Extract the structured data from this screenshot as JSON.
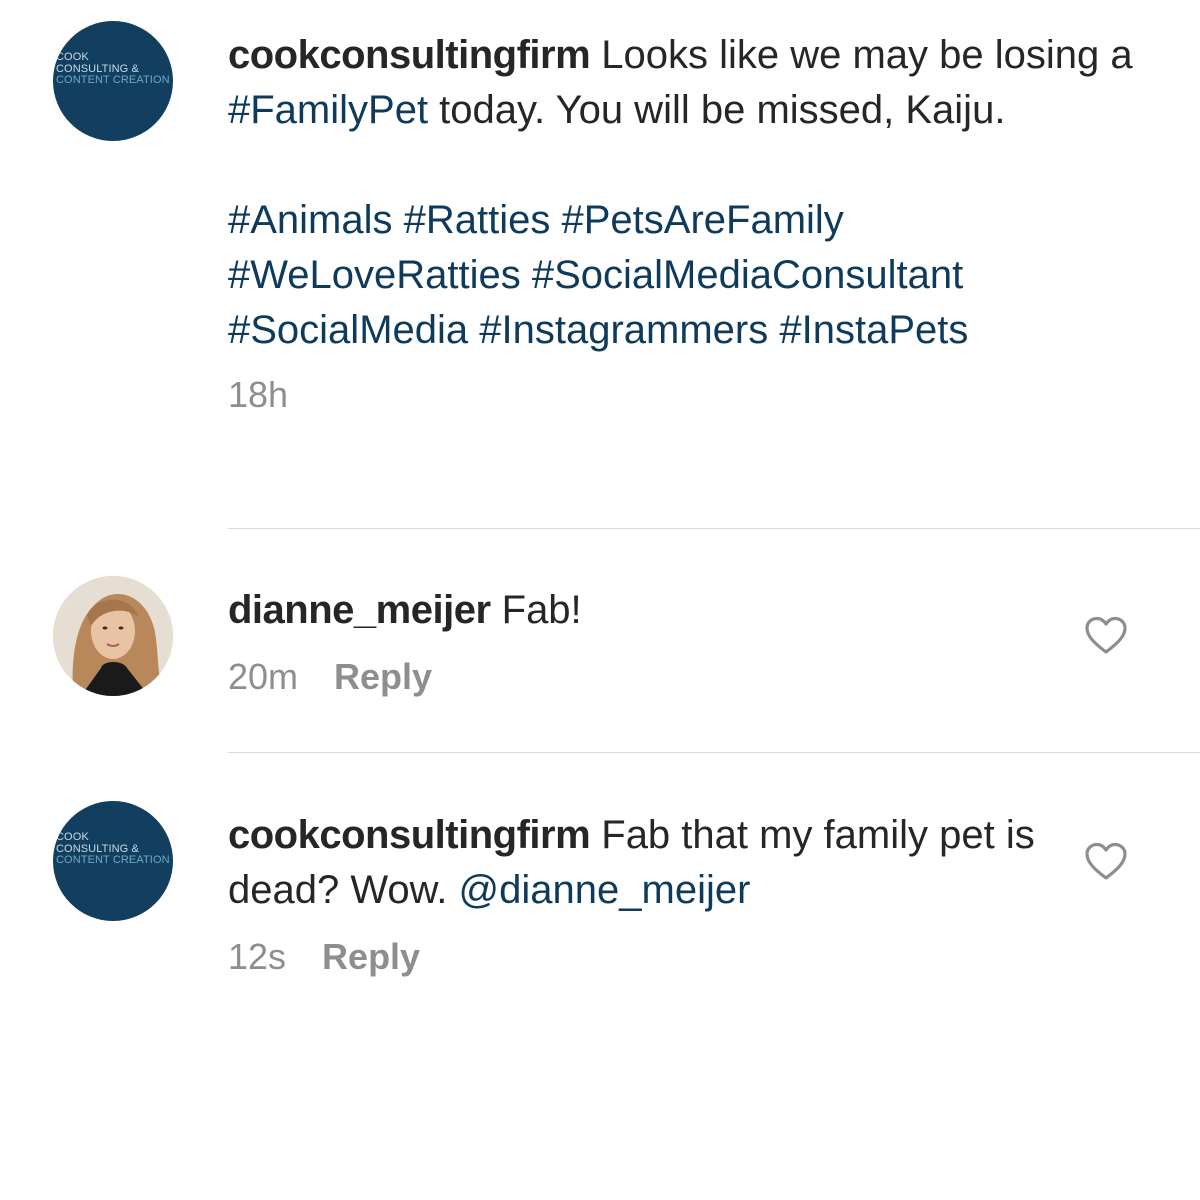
{
  "brand_avatar": {
    "line1": "COOK",
    "line2": "CONSULTING &",
    "line3": "CONTENT CREATION"
  },
  "post": {
    "username": "cookconsultingfirm",
    "caption_part1": " Looks like we may be losing a ",
    "caption_tag": "#FamilyPet",
    "caption_part2": " today. You will be missed, Kaiju.",
    "hashtags_line1": "#Animals #Ratties #PetsAreFamily",
    "hashtags_line2": "#WeLoveRatties #SocialMediaConsultant",
    "hashtags_line3": "#SocialMedia #Instagrammers #InstaPets",
    "time": "18h"
  },
  "comments": [
    {
      "username": "dianne_meijer",
      "text": " Fab!",
      "time": "20m",
      "reply_label": "Reply",
      "like_icon": "heart-outline-icon"
    },
    {
      "username": "cookconsultingfirm",
      "text": " Fab that my family pet is dead? Wow. ",
      "mention": "@dianne_meijer",
      "time": "12s",
      "reply_label": "Reply",
      "like_icon": "heart-outline-icon"
    }
  ],
  "colors": {
    "brand_navy": "#123f5f",
    "hashtag_blue": "#0e3a5c",
    "meta_gray": "#8e8e8e",
    "text": "#262626"
  }
}
